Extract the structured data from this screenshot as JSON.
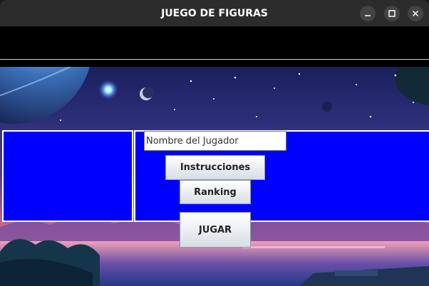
{
  "window": {
    "title": "JUEGO DE FIGURAS",
    "controls": {
      "minimize": "minimize-icon",
      "maximize": "maximize-icon",
      "close": "close-icon"
    }
  },
  "form": {
    "player_name_value": "Nombre del Jugador",
    "instructions_label": "Instrucciones",
    "ranking_label": "Ranking",
    "play_label": "JUGAR"
  },
  "colors": {
    "panel_blue": "#0000ff",
    "titlebar": "#2c2c2c",
    "background": "#000000"
  }
}
